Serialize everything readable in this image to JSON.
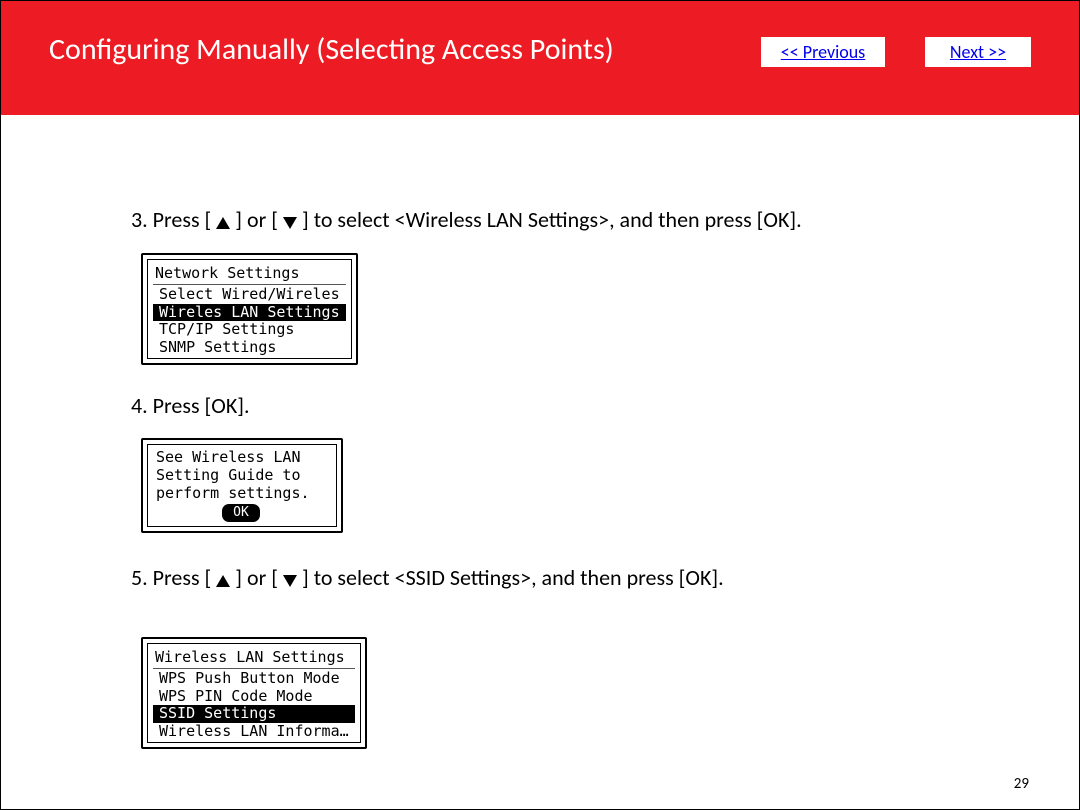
{
  "header": {
    "title": "Configuring Manually (Selecting Access Points)",
    "prev": "<< Previous",
    "next": "Next >>"
  },
  "step3": {
    "pre": "3. Press [",
    "mid1": "] or [",
    "mid2": "] to select <Wireless LAN Settings>, and then press [OK].",
    "lcd": {
      "title": "Network Settings",
      "rows": [
        {
          "text": "Select Wired/Wireles",
          "selected": false
        },
        {
          "text": "Wireles LAN Settings",
          "selected": true
        },
        {
          "text": "TCP/IP Settings",
          "selected": false
        },
        {
          "text": "SNMP Settings",
          "selected": false
        }
      ]
    }
  },
  "step4": {
    "line": "4. Press [OK].",
    "msg": {
      "l1": "See Wireless LAN",
      "l2": "Setting Guide to",
      "l3": "perform settings.",
      "ok": "OK"
    }
  },
  "step5": {
    "pre": "5. Press [",
    "mid1": "] or [",
    "mid2": "] to select <SSID Settings>, and then press [OK].",
    "lcd": {
      "title": "Wireless LAN Settings",
      "rows": [
        {
          "text": "WPS Push Button Mode",
          "selected": false
        },
        {
          "text": "WPS PIN Code Mode",
          "selected": false
        },
        {
          "text": "SSID Settings",
          "selected": true
        },
        {
          "text": "Wireless LAN Informa…",
          "selected": false
        }
      ]
    }
  },
  "page": "29"
}
